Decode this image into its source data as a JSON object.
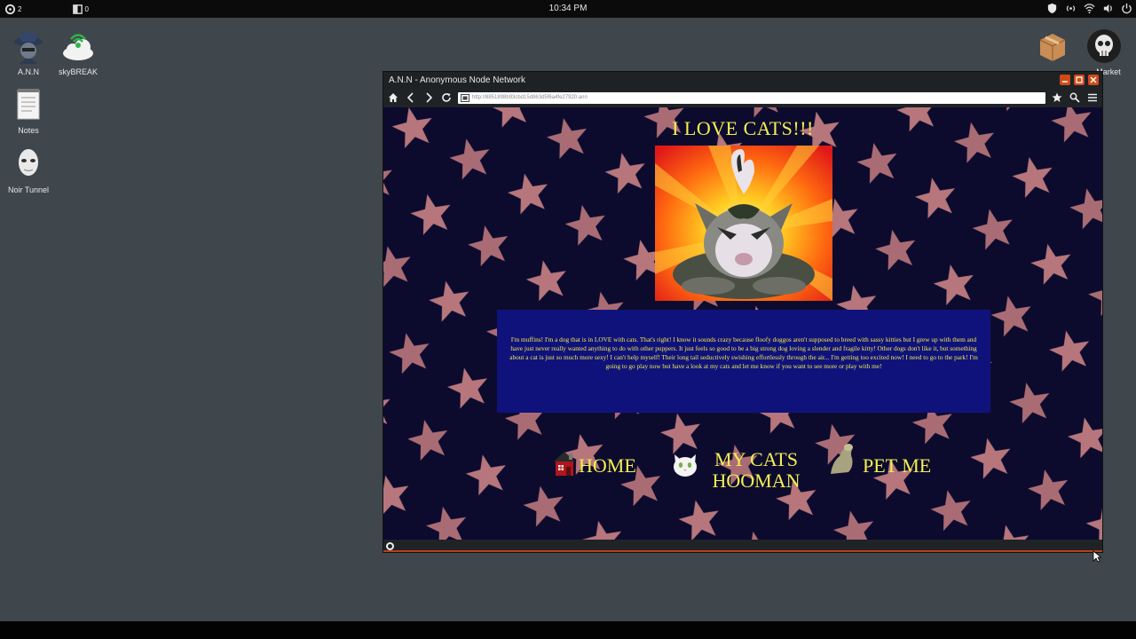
{
  "topbar": {
    "left_counter": "2",
    "left_item": "0",
    "clock": "10:34 PM"
  },
  "desktop": {
    "left_icons": [
      {
        "label": "A.N.N",
        "icon": "hacker-hat-icon"
      },
      {
        "label": "skyBREAK",
        "icon": "skybreak-cloud-icon"
      },
      {
        "label": "Notes",
        "icon": "notes-icon"
      },
      {
        "label": "Noir Tunnel",
        "icon": "mask-icon"
      }
    ],
    "right_icons": [
      {
        "label": "",
        "icon": "package-icon"
      },
      {
        "label": "Market",
        "icon": "skull-icon"
      }
    ]
  },
  "browser": {
    "title": "A.N.N - Anonymous Node Network",
    "url": "http://8851898b93cbd15d863d5f6a4fe27920.ann",
    "accent": "#d04a18"
  },
  "page": {
    "heading": "I LOVE CATS!!!",
    "body_text": "I'm muffins! I'm a dog that is in LOVE with cats. That's right! I know it sounds crazy because floofy doggos aren't supposed to breed with sassy kitties but I grew up with them and have just never really wanted anything to do with other puppers. It just feels so good to be a big strong dog loving a slender and fragile kitty! Other dogs don't like it, but something about a cat is just so much more sexy! I can't help myself! Their long tail seductively swishing effortlessly through the air... I'm getting too excited now! I need to go to the park! I'm going to go play now but have a look at my cats and let me know if you want to see more or play with me!",
    "nav": [
      {
        "label": "HOME",
        "icon": "house-icon"
      },
      {
        "label": "MY CATS HOOMAN",
        "icon": "white-cat-icon"
      },
      {
        "label": "PET ME",
        "icon": "dog-paw-icon"
      }
    ],
    "text_color": "#f4ef52",
    "box_color": "#10127c"
  }
}
